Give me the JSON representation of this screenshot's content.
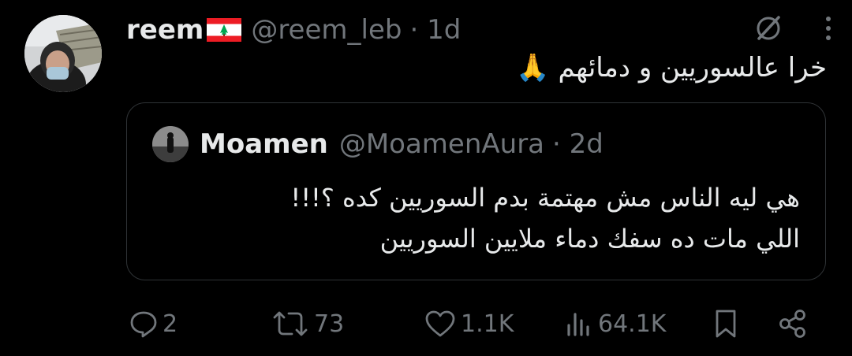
{
  "tweet": {
    "author": {
      "display_name": "reem",
      "flag_icon": "lebanon-flag-icon",
      "handle": "@reem_leb",
      "time": "· 1d"
    },
    "text": "خرا عالسوريين و دمائهم 🙏",
    "quoted": {
      "display_name": "Moamen",
      "handle": "@MoamenAura",
      "time": "· 2d",
      "lines": [
        "هي ليه الناس مش مهتمة بدم السوريين كده ؟!!!",
        "اللي مات ده سفك دماء ملايين السوريين"
      ]
    },
    "actions": {
      "replies": "2",
      "retweets": "73",
      "likes": "1.1K",
      "views": "64.1K"
    }
  },
  "colors": {
    "background": "#000000",
    "text": "#e7e9ea",
    "muted": "#71767b",
    "border": "#2f3336"
  }
}
